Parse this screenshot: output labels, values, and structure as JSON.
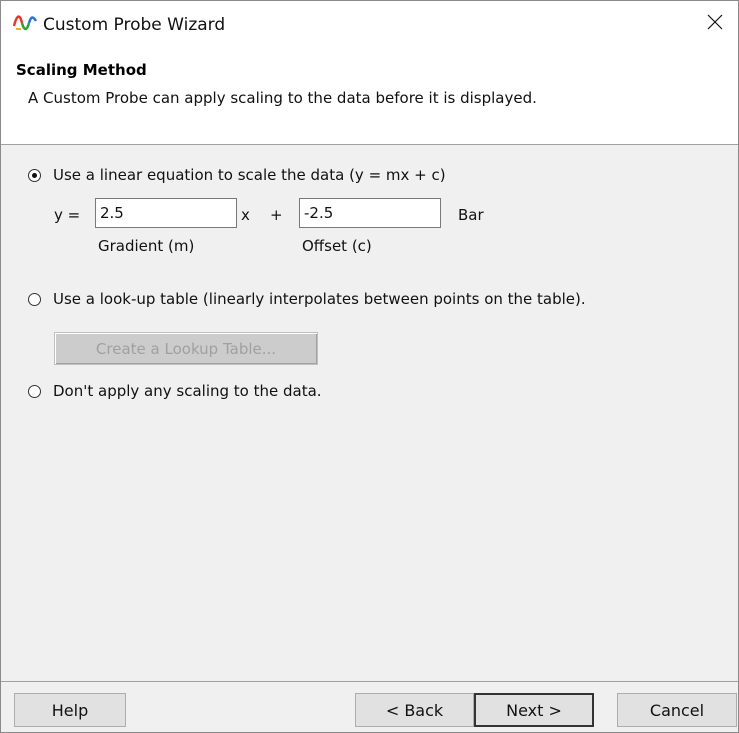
{
  "window": {
    "title": "Custom Probe Wizard",
    "icon": "waveform-app-icon",
    "close_icon": "close-icon"
  },
  "header": {
    "title": "Scaling Method",
    "description": "A Custom Probe can apply scaling to the data before it is displayed."
  },
  "options": {
    "linear": {
      "label": "Use a linear equation to scale the data (y = mx + c)",
      "selected": true
    },
    "lookup": {
      "label": "Use a look-up table (linearly interpolates between points on the table).",
      "selected": false,
      "button_label": "Create a Lookup Table...",
      "button_enabled": false
    },
    "none": {
      "label": "Don't apply any scaling to the data.",
      "selected": false
    }
  },
  "equation": {
    "prefix": "y =",
    "gradient_value": "2.5",
    "gradient_label": "Gradient (m)",
    "multiply_symbol": "x",
    "plus_symbol": "+",
    "offset_value": "-2.5",
    "offset_label": "Offset (c)",
    "unit": "Bar"
  },
  "footer": {
    "help_label": "Help",
    "back_label": "< Back",
    "next_label": "Next >",
    "cancel_label": "Cancel"
  },
  "colors": {
    "dialog_bg": "#f0f0f0",
    "header_bg": "#ffffff",
    "disabled_text": "#a0a0a0"
  }
}
